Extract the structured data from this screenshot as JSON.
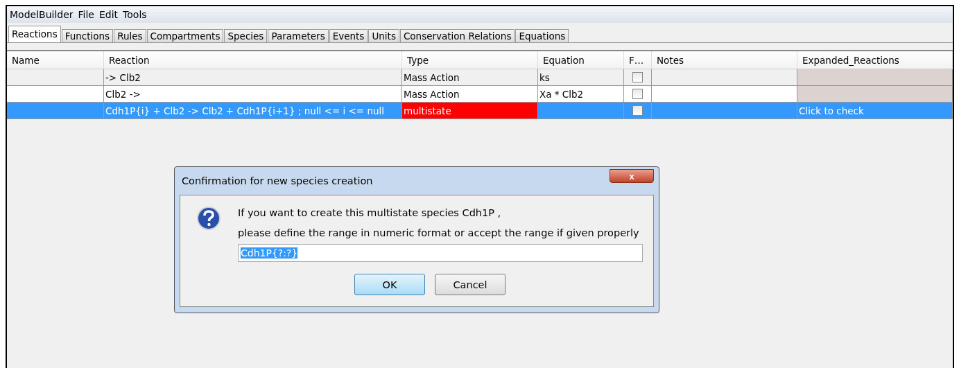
{
  "menu": [
    "ModelBuilder",
    "File",
    "Edit",
    "Tools"
  ],
  "tabs": [
    {
      "label": "Reactions",
      "selected": true
    },
    {
      "label": "Functions",
      "selected": false
    },
    {
      "label": "Rules",
      "selected": false
    },
    {
      "label": "Compartments",
      "selected": false
    },
    {
      "label": "Species",
      "selected": false
    },
    {
      "label": "Parameters",
      "selected": false
    },
    {
      "label": "Events",
      "selected": false
    },
    {
      "label": "Units",
      "selected": false
    },
    {
      "label": "Conservation Relations",
      "selected": false
    },
    {
      "label": "Equations",
      "selected": false
    }
  ],
  "table": {
    "columns": [
      "Name",
      "Reaction",
      "Type",
      "Equation",
      "F…",
      "Notes",
      "Expanded_Reactions"
    ],
    "rows": [
      {
        "selected": false,
        "reaction": "-> Clb2",
        "type": "Mass Action",
        "type_error": false,
        "equation": "ks",
        "f_checked": false
      },
      {
        "selected": false,
        "reaction": "Clb2 ->",
        "type": "Mass Action",
        "type_error": false,
        "equation": "Xa * Clb2",
        "f_checked": false
      },
      {
        "selected": true,
        "reaction": "Cdh1P{i}  + Clb2 -> Clb2 + Cdh1P{i+1}  ;  null <= i <= null",
        "type": "multistate",
        "type_error": true,
        "equation": "",
        "f_checked": false,
        "expanded": "Click to check"
      }
    ]
  },
  "dialog": {
    "title": "Confirmation for new species creation",
    "close": "x",
    "message": [
      "If you want to create this multistate species Cdh1P ,",
      " please define the range in numeric format or accept the range if given properly"
    ],
    "field": {
      "value": "Cdh1P{?:?}",
      "selected": true
    },
    "buttons": [
      {
        "label": "OK",
        "selected": true
      },
      {
        "label": "Cancel",
        "selected": false
      }
    ]
  }
}
